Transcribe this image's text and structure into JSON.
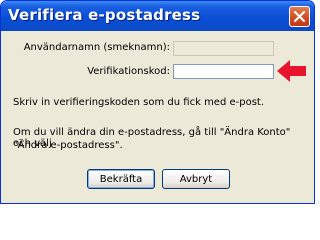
{
  "window": {
    "title": "Verifiera e-postadress"
  },
  "form": {
    "username_label": "Användarnamn (smeknamn):",
    "username_value": "",
    "code_label": "Verifikationskod:",
    "code_value": ""
  },
  "messages": {
    "line1": "Skriv in verifieringskoden som du fick med e-post.",
    "line2a": "Om du vill ändra din e-postadress, gå till \"Ändra Konto\" och välj",
    "line2b": "\"Ändra e-postadress\"."
  },
  "buttons": {
    "confirm_label": "Bekräfta",
    "cancel_label": "Avbryt"
  },
  "colors": {
    "title_bar": "#0a4fd6",
    "arrow": "#e8132c"
  },
  "icons": {
    "close": "close-icon",
    "arrow": "red-arrow-icon"
  }
}
